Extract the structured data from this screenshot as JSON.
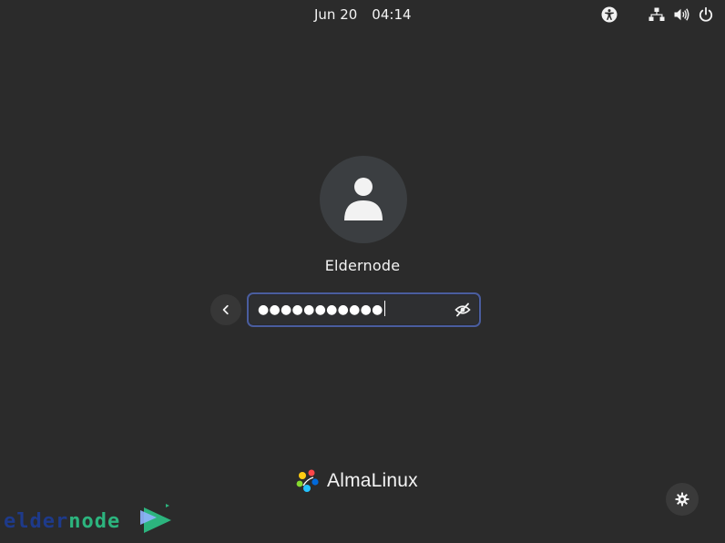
{
  "topbar": {
    "date": "Jun 20",
    "time": "04:14",
    "icons": [
      "accessibility-icon",
      "network-icon",
      "volume-icon",
      "power-icon"
    ]
  },
  "login": {
    "avatar_icon": "user-avatar-icon",
    "username": "Eldernode",
    "password_mask": "●●●●●●●●●●●",
    "back_icon": "chevron-left-icon",
    "reveal_icon": "eye-slash-icon"
  },
  "branding": {
    "logo_icon": "almalinux-logo-icon",
    "name": "AlmaLinux"
  },
  "settings": {
    "icon": "gear-icon"
  },
  "watermark": {
    "part1": "elder",
    "part2": "node",
    "color_primary": "#1e3a8a",
    "color_accent": "#2cb47e"
  },
  "colors": {
    "background": "#2b2b2b",
    "focus_ring": "#4a5d9e",
    "text": "#f4f4f4"
  }
}
